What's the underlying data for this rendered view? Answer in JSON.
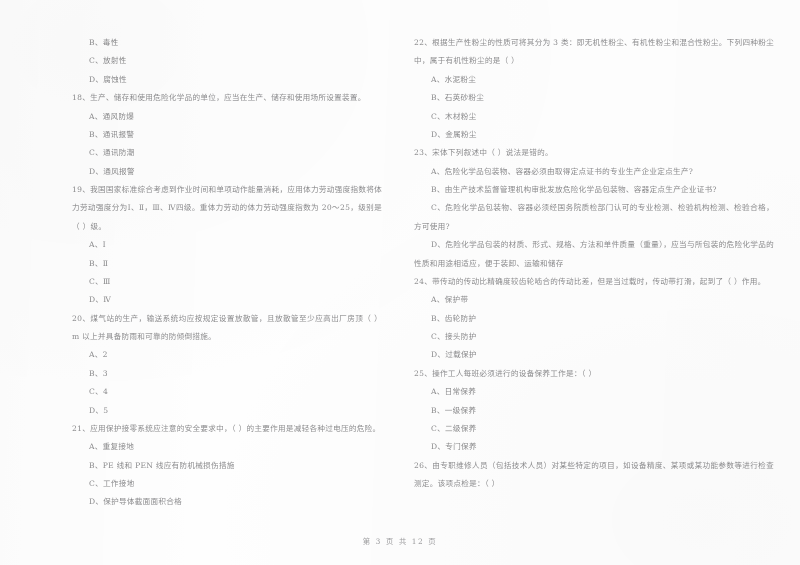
{
  "document": {
    "type": "scanned-exam-paper",
    "footer": "第 3 页 共 12 页",
    "ink_color": "#8a8a8c",
    "paper_color": "#fefefe"
  },
  "left_column": {
    "orphan_options": [
      "B、毒性",
      "C、放射性",
      "D、腐蚀性"
    ],
    "questions": [
      {
        "stem": "18、生产、储存和使用危险化学品的单位，应当在生产、储存和使用场所设置装置。",
        "options": [
          "A、通风防爆",
          "B、通讯报警",
          "C、通讯防潮",
          "D、通风报警"
        ]
      },
      {
        "stem": "19、我国国家标准综合考虑到作业时间和单项动作能量消耗，应用体力劳动强度指数将体力劳动强度分为Ⅰ、Ⅱ，Ⅲ、Ⅳ四级。重体力劳动的体力劳动强度指数为 20～25，级别是（      ）级。",
        "options": [
          "A、Ⅰ",
          "B、Ⅱ",
          "C、Ⅲ",
          "D、Ⅳ"
        ]
      },
      {
        "stem": "20、煤气站的生产，输送系统均应按规定设置放散管，且放散管至少应高出厂房顶（      ）m 以上并具备防雨和可靠的防倾倒措施。",
        "options": [
          "A、2",
          "B、3",
          "C、4",
          "D、5"
        ]
      },
      {
        "stem": "21、应用保护接零系统应注意的安全要求中，（      ）的主要作用是减轻各种过电压的危险。",
        "options": [
          "A、重复接地",
          "B、PE 线和 PEN 线应有防机械损伤措施",
          "C、工作接地",
          "D、保护导体截面面积合格"
        ]
      }
    ]
  },
  "right_column": {
    "questions": [
      {
        "stem": "22、根据生产性粉尘的性质可将其分为 3 类：即无机性粉尘、有机性粉尘和混合性粉尘。下列四种粉尘中，属于有机性粉尘的是（      ）",
        "options": [
          "A、水泥粉尘",
          "B、石英砂粉尘",
          "C、木材粉尘",
          "D、金属粉尘"
        ]
      },
      {
        "stem": "23、宋体下列叙述中（      ）说法是错的。",
        "options": [
          "A、危险化学品包装物、容器必须由取得定点证书的专业生产企业定点生产?",
          "B、由生产技术监督管理机构审批发放危险化学品包装物、容器定点生产企业证书?",
          "C、危险化学品包装物、容器必须经国务院质检部门认可的专业检测、检验机构检测、检验合格，方可使用?",
          "D、危险化学品包装的材质、形式、规格、方法和单件质量（重量），应当与所包装的危险化学品的性质和用途相适应，便于装卸、运输和储存"
        ]
      },
      {
        "stem": "24、带传动的传动比精确度较齿轮啮合的传动比差，但是当过载时，传动带打滑，起到了（      ）作用。",
        "options": [
          "A、保护带",
          "B、齿轮防护",
          "C、接头防护",
          "D、过载保护"
        ]
      },
      {
        "stem": "25、操作工人每班必须进行的设备保养工作是：（      ）",
        "options": [
          "A、日常保养",
          "B、一级保养",
          "C、二级保养",
          "D、专门保养"
        ]
      },
      {
        "stem": "26、由专职维修人员（包括技术人员）对某些特定的项目，如设备精度、某项或某功能参数等进行检查测定。该项点检是：（      ）",
        "options": []
      }
    ]
  }
}
